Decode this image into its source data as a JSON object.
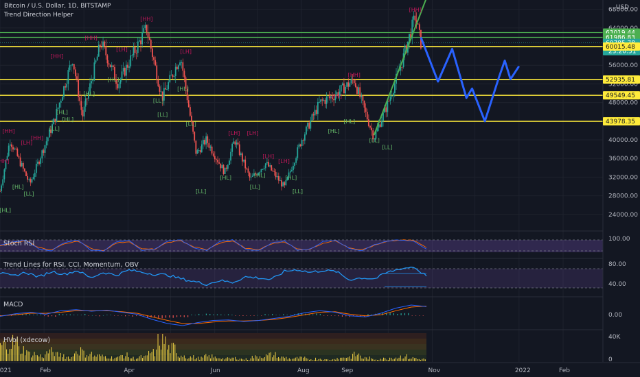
{
  "header": {
    "symbol_line": "Bitcoin / U.S. Dollar, 1D, BITSTAMP",
    "indicator": "Trend Direction Helper",
    "currency": "USD"
  },
  "colors": {
    "background": "#131722",
    "up": "#26a69a",
    "down": "#ef5350",
    "green_line": "#4caf50",
    "yellow_line": "#ffeb3b",
    "projection": "#2962ff",
    "hh_label": "#c2185b",
    "hl_label": "#66bb6a",
    "current_price_bg": "#26a69a"
  },
  "panes": {
    "stoch_rsi": "Stoch RSI",
    "trend_lines": "Trend Lines for RSI, CCI, Momentum, OBV",
    "macd": "MACD",
    "hvol": "HVol (xdecow)"
  },
  "chart_data": {
    "type": "candlestick",
    "main_axis": {
      "ylim": [
        20000,
        70000
      ],
      "ticks": [
        "68000.00",
        "64000.00",
        "60000.00",
        "56000.00",
        "52000.00",
        "48000.00",
        "44000.00",
        "40000.00",
        "36000.00",
        "32000.00",
        "28000.00",
        "24000.00"
      ]
    },
    "x_ticks": [
      "2021",
      "Feb",
      "Apr",
      "Jun",
      "Aug",
      "Sep",
      "Nov",
      "2022",
      "Feb"
    ],
    "price_path": [
      {
        "date": "2021-01-01",
        "close": 29000
      },
      {
        "date": "2021-01-08",
        "close": 40000
      },
      {
        "date": "2021-01-22",
        "close": 30500
      },
      {
        "date": "2021-02-08",
        "close": 44000
      },
      {
        "date": "2021-02-21",
        "close": 57500
      },
      {
        "date": "2021-02-28",
        "close": 45000
      },
      {
        "date": "2021-03-13",
        "close": 61000
      },
      {
        "date": "2021-03-25",
        "close": 52000
      },
      {
        "date": "2021-04-14",
        "close": 64000
      },
      {
        "date": "2021-04-25",
        "close": 49000
      },
      {
        "date": "2021-05-08",
        "close": 58000
      },
      {
        "date": "2021-05-19",
        "close": 37000
      },
      {
        "date": "2021-05-26",
        "close": 40000
      },
      {
        "date": "2021-06-08",
        "close": 33000
      },
      {
        "date": "2021-06-15",
        "close": 40000
      },
      {
        "date": "2021-06-26",
        "close": 31500
      },
      {
        "date": "2021-07-07",
        "close": 35000
      },
      {
        "date": "2021-07-20",
        "close": 29800
      },
      {
        "date": "2021-08-01",
        "close": 40000
      },
      {
        "date": "2021-08-14",
        "close": 48000
      },
      {
        "date": "2021-08-24",
        "close": 49500
      },
      {
        "date": "2021-09-07",
        "close": 52900
      },
      {
        "date": "2021-09-21",
        "close": 40500
      },
      {
        "date": "2021-10-01",
        "close": 48000
      },
      {
        "date": "2021-10-10",
        "close": 56000
      },
      {
        "date": "2021-10-20",
        "close": 66500
      },
      {
        "date": "2021-10-24",
        "close": 60785.78
      }
    ],
    "horizontal_levels": [
      {
        "price": 63019.44,
        "label": "63019.44",
        "color": "green"
      },
      {
        "price": 61986.83,
        "label": "61986.83",
        "color": "green"
      },
      {
        "price": 60785.78,
        "label": "60785.78",
        "sublabel": "23:20:51",
        "color": "current"
      },
      {
        "price": 60015.48,
        "label": "60015.48",
        "color": "yellow"
      },
      {
        "price": 52935.81,
        "label": "52935.81",
        "color": "yellow"
      },
      {
        "price": 49549.45,
        "label": "49549.45",
        "color": "yellow"
      },
      {
        "price": 43978.35,
        "label": "43978.35",
        "color": "yellow"
      }
    ],
    "trendline": {
      "from": {
        "date": "2021-09-21",
        "price": 41000
      },
      "to": {
        "date": "2021-10-28",
        "price": 70500
      }
    },
    "projection_path": [
      {
        "date": "2021-10-24",
        "price": 62000
      },
      {
        "date": "2021-11-05",
        "price": 52500
      },
      {
        "date": "2021-11-15",
        "price": 59500
      },
      {
        "date": "2021-11-25",
        "price": 49000
      },
      {
        "date": "2021-11-29",
        "price": 51000
      },
      {
        "date": "2021-12-08",
        "price": 44000
      },
      {
        "date": "2021-12-18",
        "price": 53500
      },
      {
        "date": "2021-12-22",
        "price": 57000
      },
      {
        "date": "2021-12-26",
        "price": 53000
      },
      {
        "date": "2022-01-01",
        "price": 55800
      }
    ],
    "swing_labels": [
      {
        "text": "[HH]",
        "date": "2021-01-03",
        "price": 35000,
        "kind": "hh"
      },
      {
        "text": "[HL]",
        "date": "2021-01-05",
        "price": 24500,
        "kind": "hl"
      },
      {
        "text": "[HH]",
        "date": "2021-01-07",
        "price": 41500,
        "kind": "hh"
      },
      {
        "text": "[HL]",
        "date": "2021-01-14",
        "price": 29500,
        "kind": "hl"
      },
      {
        "text": "[LL]",
        "date": "2021-01-22",
        "price": 28000,
        "kind": "hl"
      },
      {
        "text": "[LH]",
        "date": "2021-01-20",
        "price": 39000,
        "kind": "hh"
      },
      {
        "text": "[HH]",
        "date": "2021-01-27",
        "price": 40000,
        "kind": "hh"
      },
      {
        "text": "[HH]",
        "date": "2021-02-10",
        "price": 57500,
        "kind": "hh"
      },
      {
        "text": "[HH]",
        "date": "2021-03-06",
        "price": 61500,
        "kind": "hh"
      },
      {
        "text": "[HL]",
        "date": "2021-02-14",
        "price": 45500,
        "kind": "hl"
      },
      {
        "text": "[HL]",
        "date": "2021-02-18",
        "price": 44000,
        "kind": "hl"
      },
      {
        "text": "[LL]",
        "date": "2021-02-09",
        "price": 42000,
        "kind": "hl"
      },
      {
        "text": "[HL]",
        "date": "2021-03-05",
        "price": 49500,
        "kind": "hl"
      },
      {
        "text": "[HL]",
        "date": "2021-03-22",
        "price": 52500,
        "kind": "hl"
      },
      {
        "text": "[LH]",
        "date": "2021-03-28",
        "price": 59000,
        "kind": "hh"
      },
      {
        "text": "[HH]",
        "date": "2021-04-14",
        "price": 65500,
        "kind": "hh"
      },
      {
        "text": "[LL]",
        "date": "2021-04-23",
        "price": 48000,
        "kind": "hl"
      },
      {
        "text": "[LL]",
        "date": "2021-04-26",
        "price": 45000,
        "kind": "hl"
      },
      {
        "text": "[LH]",
        "date": "2021-05-12",
        "price": 58500,
        "kind": "hh"
      },
      {
        "text": "[HL]",
        "date": "2021-05-10",
        "price": 50500,
        "kind": "hl"
      },
      {
        "text": "[LL]",
        "date": "2021-05-16",
        "price": 43000,
        "kind": "hl"
      },
      {
        "text": "[LH]",
        "date": "2021-06-15",
        "price": 41000,
        "kind": "hh"
      },
      {
        "text": "[LH]",
        "date": "2021-06-28",
        "price": 41000,
        "kind": "hh"
      },
      {
        "text": "[HL]",
        "date": "2021-06-09",
        "price": 31500,
        "kind": "hl"
      },
      {
        "text": "[LL]",
        "date": "2021-05-23",
        "price": 28500,
        "kind": "hl"
      },
      {
        "text": "[LL]",
        "date": "2021-06-30",
        "price": 29500,
        "kind": "hl"
      },
      {
        "text": "[HL]",
        "date": "2021-07-03",
        "price": 32000,
        "kind": "hl"
      },
      {
        "text": "[LH]",
        "date": "2021-07-09",
        "price": 36000,
        "kind": "hh"
      },
      {
        "text": "[LH]",
        "date": "2021-07-20",
        "price": 35000,
        "kind": "hh"
      },
      {
        "text": "[HL]",
        "date": "2021-07-25",
        "price": 31500,
        "kind": "hl"
      },
      {
        "text": "[LL]",
        "date": "2021-07-30",
        "price": 28500,
        "kind": "hl"
      },
      {
        "text": "[HH]",
        "date": "2021-08-25",
        "price": 49000,
        "kind": "hh"
      },
      {
        "text": "[HH]",
        "date": "2021-09-07",
        "price": 53500,
        "kind": "hh"
      },
      {
        "text": "[HL]",
        "date": "2021-08-24",
        "price": 41500,
        "kind": "hl"
      },
      {
        "text": "[HL]",
        "date": "2021-09-04",
        "price": 43500,
        "kind": "hl"
      },
      {
        "text": "[LL]",
        "date": "2021-09-22",
        "price": 39500,
        "kind": "hl"
      },
      {
        "text": "[LL]",
        "date": "2021-10-01",
        "price": 38000,
        "kind": "hl"
      },
      {
        "text": "[HH]",
        "date": "2021-10-20",
        "price": 67500,
        "kind": "hh"
      }
    ],
    "stoch_rsi": {
      "ylim": [
        0,
        100
      ],
      "ticks": [
        "100.00"
      ],
      "k": [
        55,
        80,
        90,
        30,
        20,
        75,
        90,
        25,
        15,
        80,
        85,
        20,
        30,
        85,
        90,
        40,
        20,
        80,
        90,
        30,
        20,
        70,
        85,
        25,
        30,
        80,
        90,
        35,
        20,
        60,
        85,
        90,
        85,
        30
      ],
      "d": [
        50,
        70,
        85,
        40,
        25,
        65,
        85,
        35,
        20,
        70,
        80,
        30,
        30,
        75,
        85,
        45,
        25,
        70,
        85,
        35,
        25,
        65,
        80,
        30,
        30,
        70,
        85,
        40,
        25,
        55,
        80,
        90,
        88,
        40
      ]
    },
    "trend_lines_osc": {
      "ylim": [
        30,
        90
      ],
      "ticks": [
        "80.00",
        "40.00"
      ],
      "values": [
        68,
        62,
        70,
        60,
        72,
        66,
        74,
        58,
        70,
        64,
        75,
        70,
        66,
        64,
        56,
        50,
        44,
        52,
        48,
        60,
        58,
        54,
        72,
        76,
        70,
        74,
        72,
        54,
        58,
        56,
        70,
        78,
        82,
        62
      ]
    },
    "macd": {
      "ticks": [
        "0.00"
      ],
      "macd": [
        -0.2,
        0.3,
        0.6,
        0.2,
        0.9,
        1.1,
        0.8,
        1.0,
        0.6,
        0.2,
        -0.8,
        -1.6,
        -2.0,
        -1.4,
        -1.0,
        -0.9,
        -1.2,
        -1.0,
        -0.6,
        -0.2,
        0.5,
        0.9,
        0.6,
        -0.1,
        -0.3,
        0.4,
        1.4,
        2.0,
        1.7
      ],
      "signal": [
        -0.1,
        0.1,
        0.4,
        0.4,
        0.6,
        0.9,
        0.9,
        0.9,
        0.7,
        0.4,
        -0.3,
        -1.0,
        -1.6,
        -1.6,
        -1.3,
        -1.1,
        -1.1,
        -1.0,
        -0.8,
        -0.4,
        0.1,
        0.6,
        0.7,
        0.2,
        -0.1,
        0.1,
        0.9,
        1.6,
        1.8
      ]
    },
    "hvol": {
      "ylim": [
        0,
        40000
      ],
      "ticks": [
        "40K",
        "0"
      ],
      "values": [
        30,
        36,
        22,
        14,
        10,
        18,
        12,
        8,
        20,
        14,
        10,
        9,
        7,
        11,
        6,
        8,
        16,
        38,
        24,
        12,
        8,
        6,
        9,
        7,
        5,
        6,
        4,
        8,
        10,
        12,
        7,
        5,
        6,
        4,
        5,
        3,
        6,
        8,
        12,
        6,
        4,
        5,
        7,
        9,
        6,
        4
      ]
    }
  }
}
